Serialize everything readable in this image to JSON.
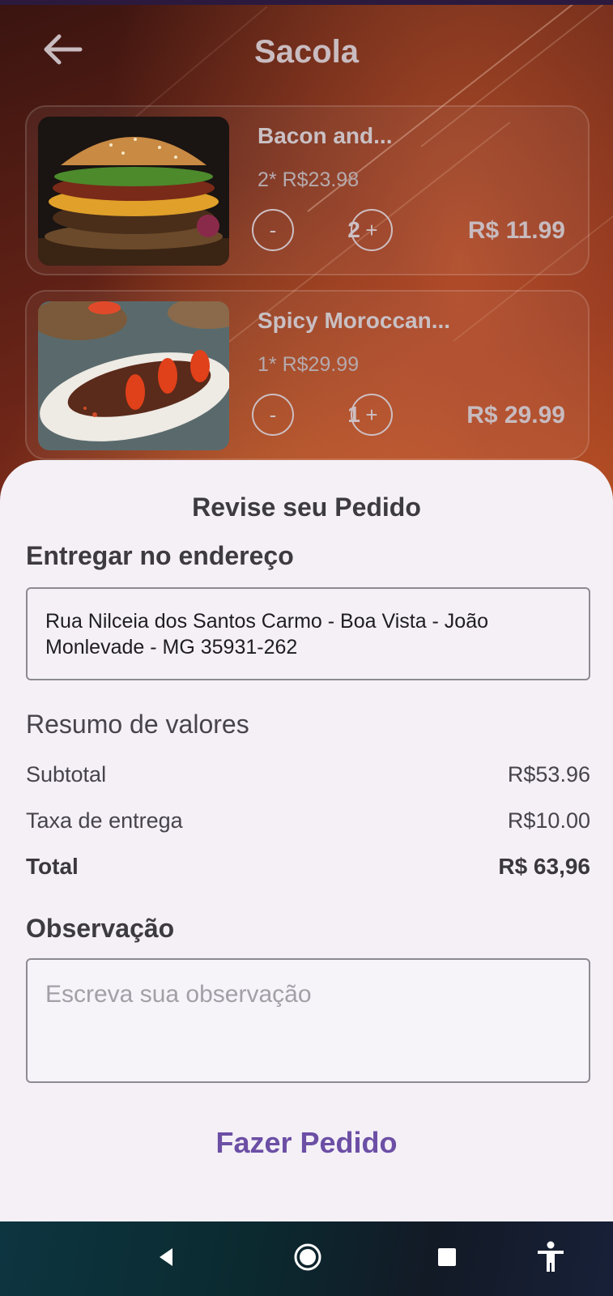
{
  "header": {
    "title": "Sacola",
    "back_icon": "arrow-left-icon"
  },
  "cart": {
    "items": [
      {
        "name": "Bacon and...",
        "summary": "2* R$23.98",
        "qty": "2",
        "price": "R$ 11.99",
        "decrement": "-",
        "increment": "+",
        "image": "burger-photo"
      },
      {
        "name": "Spicy Moroccan...",
        "summary": "1* R$29.99",
        "qty": "1",
        "price": "R$ 29.99",
        "decrement": "-",
        "increment": "+",
        "image": "grilled-meat-photo"
      }
    ]
  },
  "sheet": {
    "title": "Revise seu Pedido",
    "address_heading": "Entregar no endereço",
    "address_value": "Rua Nilceia dos Santos Carmo - Boa Vista - João Monlevade - MG  35931-262",
    "summary_heading": "Resumo de valores",
    "subtotal_label": "Subtotal",
    "subtotal_value": "R$53.96",
    "fee_label": "Taxa de entrega",
    "fee_value": "R$10.00",
    "total_label": "Total",
    "total_value": "R$ 63,96",
    "obs_heading": "Observação",
    "obs_placeholder": "Escreva sua observação",
    "cta_label": "Fazer Pedido"
  },
  "navbar": {
    "items": [
      "back-triangle-icon",
      "home-circle-icon",
      "recents-square-icon",
      "accessibility-icon"
    ]
  },
  "colors": {
    "accent": "#6c4fa5",
    "sheet_bg": "#f4f0f6",
    "text_dark": "#3d3a40"
  }
}
